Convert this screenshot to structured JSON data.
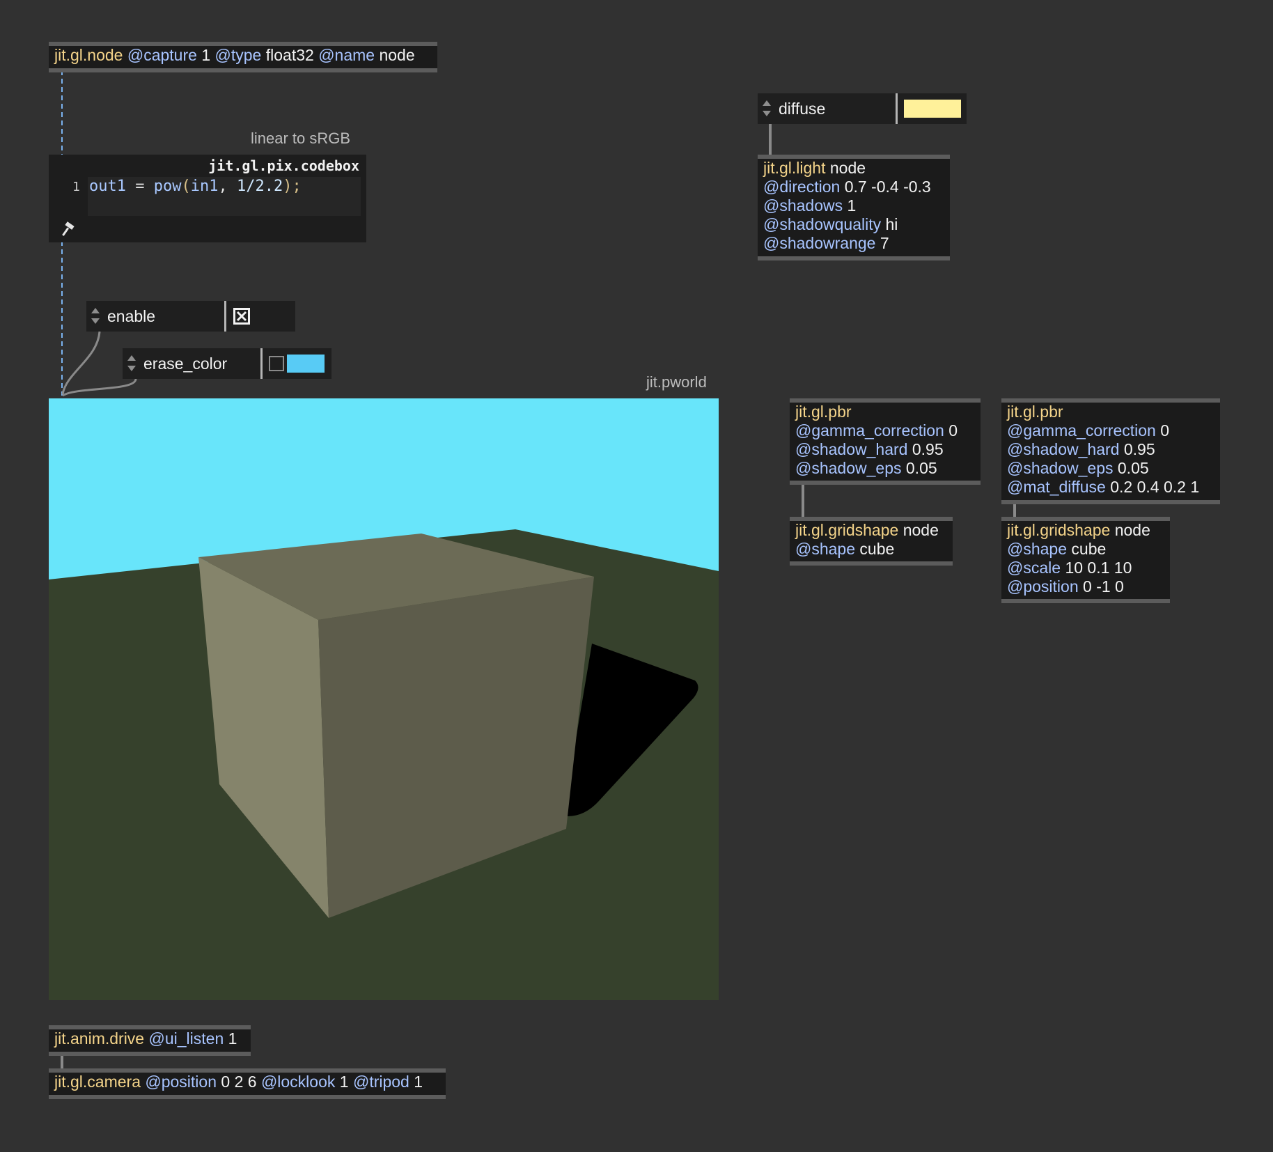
{
  "colors": {
    "background": "#313131",
    "object_bg": "#1b1b1b",
    "keyword": "#f4d48a",
    "attribute": "#a8c4ff",
    "value": "#f2f2f2",
    "sky": "#68e5fa",
    "ground": "#36412c",
    "diffuse_swatch": "#fff19a",
    "erase_swatch": "#58cbf5"
  },
  "node": {
    "keyword": "jit.gl.node",
    "attr1": "@capture",
    "val1": "1",
    "attr2": "@type",
    "val2": "float32",
    "attr3": "@name",
    "val3": "node"
  },
  "comments": {
    "linear_to_srgb": "linear to sRGB",
    "pworld": "jit.pworld"
  },
  "codebox": {
    "title": "jit.gl.pix.codebox",
    "line_number": "1",
    "code_out": "out1",
    "code_eq": " = ",
    "code_fn": "pow",
    "code_open": "(",
    "code_arg1": "in1",
    "code_sep": ", ",
    "code_arg2": "1/2.2",
    "code_close": ");",
    "icon": "hammer-icon"
  },
  "enable_attr": {
    "label": "enable",
    "checked": true,
    "checkbox_icon": "x-checkbox-icon"
  },
  "erase_color_attr": {
    "label": "erase_color"
  },
  "diffuse_attr": {
    "label": "diffuse"
  },
  "light": {
    "keyword": "jit.gl.light",
    "name": "node",
    "lines": [
      {
        "attr": "@direction",
        "val": "0.7 -0.4 -0.3"
      },
      {
        "attr": "@shadows",
        "val": "1"
      },
      {
        "attr": "@shadowquality",
        "val": "hi"
      },
      {
        "attr": "@shadowrange",
        "val": "7"
      }
    ]
  },
  "pbr1": {
    "keyword": "jit.gl.pbr",
    "lines": [
      {
        "attr": "@gamma_correction",
        "val": "0"
      },
      {
        "attr": "@shadow_hard",
        "val": "0.95"
      },
      {
        "attr": "@shadow_eps",
        "val": "0.05"
      }
    ]
  },
  "pbr2": {
    "keyword": "jit.gl.pbr",
    "lines": [
      {
        "attr": "@gamma_correction",
        "val": "0"
      },
      {
        "attr": "@shadow_hard",
        "val": "0.95"
      },
      {
        "attr": "@shadow_eps",
        "val": "0.05"
      },
      {
        "attr": "@mat_diffuse",
        "val": "0.2 0.4 0.2 1"
      }
    ]
  },
  "gridshape1": {
    "keyword": "jit.gl.gridshape",
    "name": "node",
    "attr": "@shape",
    "val": "cube"
  },
  "gridshape2": {
    "keyword": "jit.gl.gridshape",
    "name": "node",
    "lines": [
      {
        "attr": "@shape",
        "val": "cube"
      },
      {
        "attr": "@scale",
        "val": "10 0.1 10"
      },
      {
        "attr": "@position",
        "val": "0 -1 0"
      }
    ]
  },
  "anim": {
    "keyword": "jit.anim.drive",
    "attr": "@ui_listen",
    "val": "1"
  },
  "camera": {
    "keyword": "jit.gl.camera",
    "attr1": "@position",
    "val1": "0 2 6",
    "attr2": "@locklook",
    "val2": "1",
    "attr3": "@tripod",
    "val3": "1"
  }
}
